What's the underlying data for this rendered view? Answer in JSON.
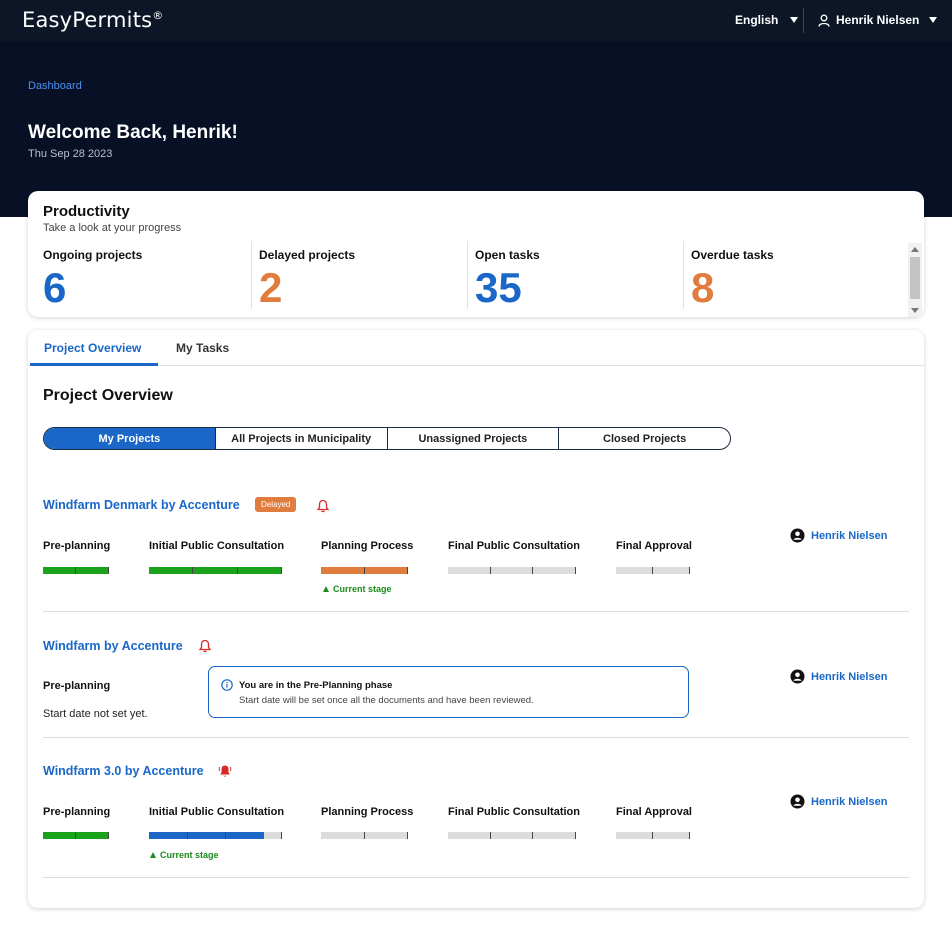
{
  "header": {
    "logo_text": "EasyPermits",
    "logo_mark": "®",
    "language": "English",
    "user_name": "Henrik Nielsen"
  },
  "hero": {
    "breadcrumb": "Dashboard",
    "welcome": "Welcome Back, Henrik!",
    "date": "Thu Sep 28 2023"
  },
  "productivity": {
    "title": "Productivity",
    "subtitle": "Take a look at your progress",
    "stats": [
      {
        "label": "Ongoing projects",
        "value": "6",
        "color": "#1a67c8"
      },
      {
        "label": "Delayed projects",
        "value": "2",
        "color": "#e07c3e"
      },
      {
        "label": "Open tasks",
        "value": "35",
        "color": "#1a67c8"
      },
      {
        "label": "Overdue tasks",
        "value": "8",
        "color": "#e07c3e"
      }
    ]
  },
  "tabs": {
    "project_overview": "Project Overview",
    "my_tasks": "My Tasks"
  },
  "main": {
    "title": "Project Overview",
    "filters": [
      "My Projects",
      "All Projects in Municipality",
      "Unassigned Projects",
      "Closed Projects"
    ],
    "active_filter": 0
  },
  "stage_names": [
    "Pre-planning",
    "Initial Public Consultation",
    "Planning Process",
    "Final Public Consultation",
    "Final Approval"
  ],
  "current_stage_label": "Current stage",
  "projects": [
    {
      "name": "Windfarm Denmark by Accenture",
      "badge": "Delayed",
      "bell": "outline",
      "assignee": "Henrik Nielsen",
      "current_stage_index": 2
    },
    {
      "name": "Windfarm by Accenture",
      "bell": "outline",
      "assignee": "Henrik Nielsen",
      "stage": "Pre-planning",
      "start_note": "Start date not set yet.",
      "info_title": "You are in the Pre-Planning phase",
      "info_text": "Start date will be set once all the documents and have been reviewed."
    },
    {
      "name": "Windfarm 3.0 by Accenture",
      "bell": "filled",
      "assignee": "Henrik Nielsen",
      "current_stage_index": 1
    }
  ],
  "colors": {
    "complete": "#1ba21b",
    "delayed": "#e07c3e",
    "in_progress": "#1a67c8",
    "pending": "#dcdcdc",
    "bell_alert": "#d42a2a"
  }
}
